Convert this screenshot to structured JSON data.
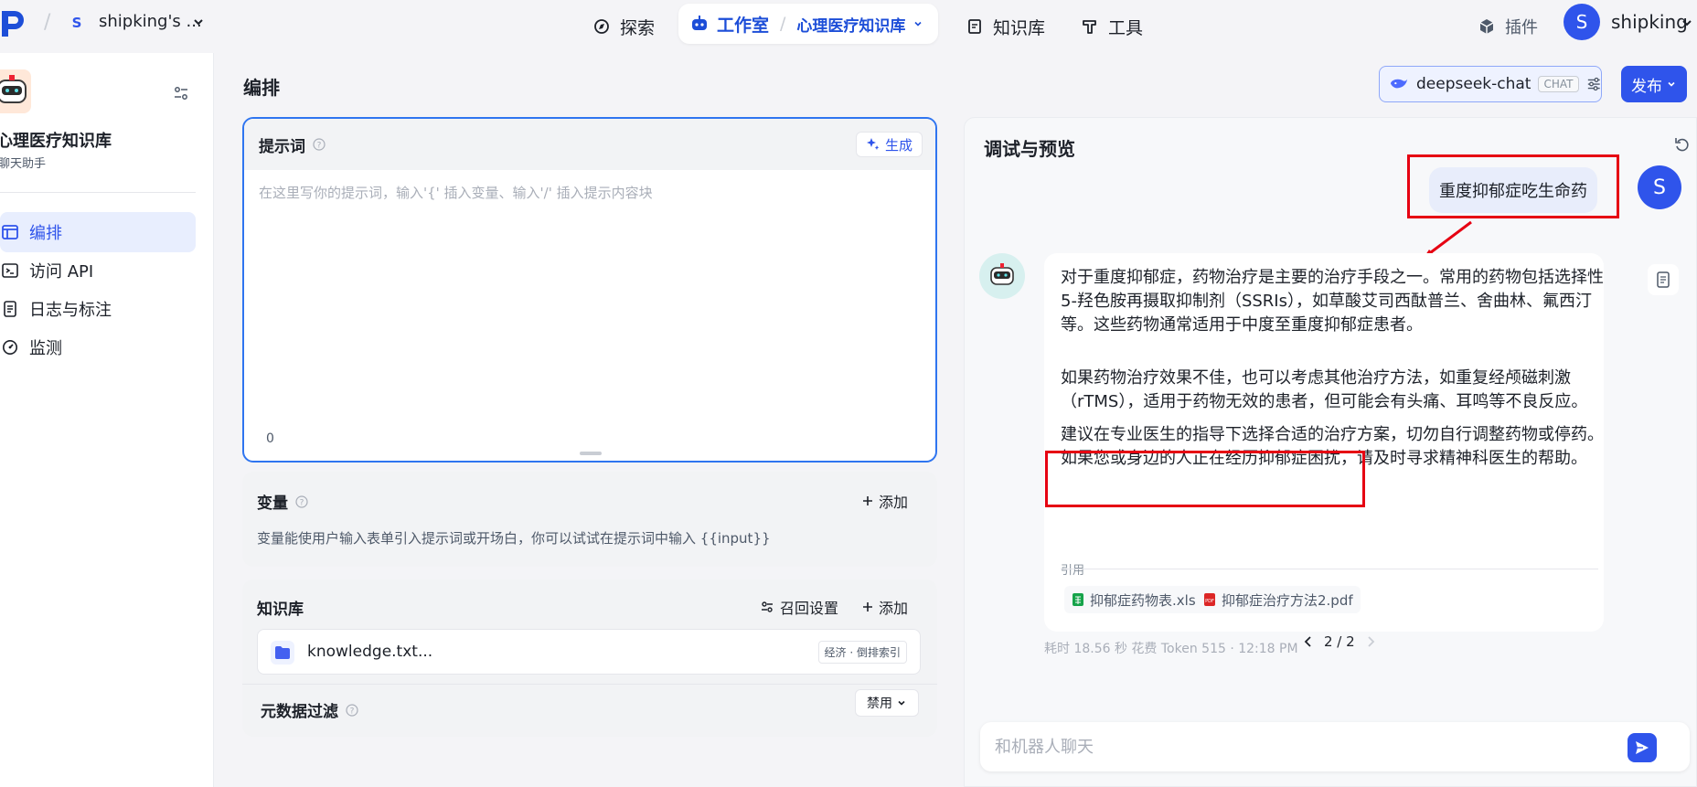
{
  "topnav": {
    "team_initial": "S",
    "team_name": "shipking's ...",
    "explore": "探索",
    "workspace": "工作室",
    "workspace_app": "心理医疗知识库",
    "knowledge": "知识库",
    "tools": "工具",
    "plugins": "插件",
    "user_initial": "S",
    "user_name": "shipking"
  },
  "sidebar": {
    "app_name": "心理医疗知识库",
    "app_type": "聊天助手",
    "items": [
      {
        "label": "编排",
        "icon": "layout-icon",
        "active": true
      },
      {
        "label": "访问 API",
        "icon": "terminal-icon",
        "active": false
      },
      {
        "label": "日志与标注",
        "icon": "document-icon",
        "active": false
      },
      {
        "label": "监测",
        "icon": "gauge-icon",
        "active": false
      }
    ]
  },
  "main": {
    "title": "编排",
    "model": {
      "name": "deepseek-chat",
      "tag": "CHAT"
    },
    "publish": "发布",
    "prompt": {
      "label": "提示词",
      "generate": "生成",
      "placeholder": "在这里写你的提示词，输入'{' 插入变量、输入'/' 插入提示内容块",
      "count": "0"
    },
    "variables": {
      "label": "变量",
      "add": "添加",
      "description": "变量能使用户输入表单引入提示词或开场白，你可以试试在提示词中输入 {{input}}"
    },
    "knowledge": {
      "label": "知识库",
      "retrieval": "召回设置",
      "add": "添加",
      "item_name": "knowledge.txt...",
      "item_tag": "经济 · 倒排索引",
      "metadata_label": "元数据过滤",
      "metadata_value": "禁用"
    }
  },
  "preview": {
    "title": "调试与预览",
    "user_message": "重度抑郁症吃生命药",
    "user_initial": "S",
    "answer": [
      "对于重度抑郁症，药物治疗是主要的治疗手段之一。常用的药物包括选择性5-羟色胺再摄取抑制剂（SSRIs），如草酸艾司西酞普兰、舍曲林、氟西汀等。这些药物通常适用于中度至重度抑郁症患者。",
      "如果药物治疗效果不佳，也可以考虑其他治疗方法，如重复经颅磁刺激（rTMS），适用于药物无效的患者，但可能会有头痛、耳鸣等不良反应。",
      "建议在专业医生的指导下选择合适的治疗方案，切勿自行调整药物或停药。如果您或身边的人正在经历抑郁症困扰，请及时寻求精神科医生的帮助。"
    ],
    "citation_label": "引用",
    "citations": [
      {
        "name": "抑郁症药物表.xlsx",
        "icon": "spreadsheet-icon",
        "color": "#16a34a"
      },
      {
        "name": "抑郁症治疗方法2.pdf",
        "icon": "pdf-icon",
        "color": "#dc2626"
      }
    ],
    "pager": "2 / 2",
    "meta": "耗时 18.56 秒   花费 Token 515  ·  12:18 PM",
    "input_placeholder": "和机器人聊天"
  },
  "colors": {
    "accent": "#2f54eb",
    "annotation_red": "#e60012"
  }
}
